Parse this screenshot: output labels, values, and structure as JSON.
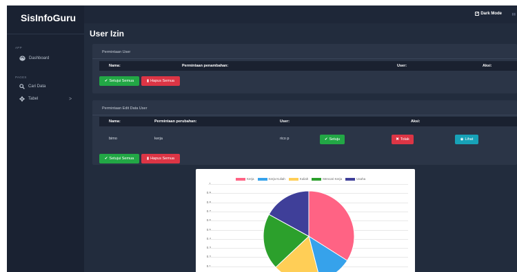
{
  "app": {
    "brand": "SisInfoGuru"
  },
  "sidebar": {
    "sections": [
      {
        "heading": "APP",
        "items": [
          {
            "label": "Dashboard",
            "icon": "palette-icon"
          }
        ]
      },
      {
        "heading": "PAGES",
        "items": [
          {
            "label": "Cari Data",
            "icon": "search-icon"
          },
          {
            "label": "Tabel",
            "icon": "gear-icon",
            "chevron": ">"
          }
        ]
      }
    ]
  },
  "topbar": {
    "dark_mode_label": "Dark Mode",
    "dark_mode_checked": true,
    "dark_mode_check_glyph": "✓"
  },
  "page": {
    "title": "User Izin"
  },
  "permintaan_user": {
    "title": "Permintaan User",
    "columns": [
      "Nama:",
      "Permintaan penambahan:",
      "User:",
      "Aksi:"
    ],
    "approve_all_label": "Setujui Semua",
    "delete_all_label": "Hapus Semua"
  },
  "permintaan_edit": {
    "title": "Permintaan Edit Data User",
    "columns": [
      "Nama:",
      "Permintaan perubahan:",
      "User:",
      "Aksi:"
    ],
    "rows": [
      {
        "nama": "bimo",
        "perubahan": "kerja",
        "user": "rico p",
        "approve_label": "Setuju",
        "reject_label": "Tolak",
        "view_label": "Lihat"
      }
    ],
    "approve_all_label": "Setujui Semua",
    "delete_all_label": "Hapus Semua"
  },
  "colors": {
    "green": "#22a745",
    "red": "#dc3545",
    "cyan": "#17a2b8"
  },
  "chart_data": {
    "type": "pie",
    "legend_position": "top",
    "labels": [
      "Kerja",
      "Kerja Kuliah",
      "Kuliah",
      "Mencari Kerja",
      "Usaha"
    ],
    "values": [
      0.34,
      0.12,
      0.17,
      0.2,
      0.17
    ],
    "colors": [
      "#ff6384",
      "#36a2eb",
      "#ffce56",
      "#2ca02c",
      "#3f3f99"
    ],
    "yticks": [
      "1",
      "0.9",
      "0.8",
      "0.7",
      "0.6",
      "0.5",
      "0.4",
      "0.3",
      "0.2",
      "0.1"
    ]
  }
}
